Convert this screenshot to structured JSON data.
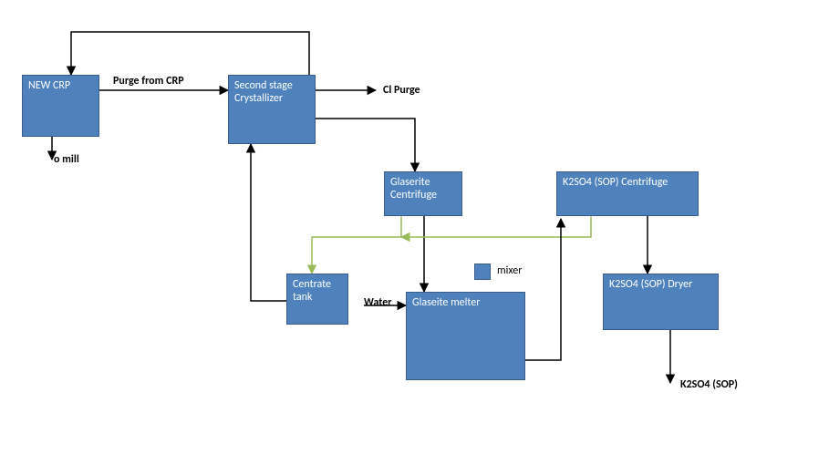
{
  "boxes": {
    "new_crp": "NEW CRP",
    "second_stage": "Second stage Crystallizer",
    "glaserite_centrifuge": "Glaserite Centrifuge",
    "k2so4_centrifuge": "K2SO4  (SOP) Centrifuge",
    "centrate_tank": "Centrate tank",
    "glaseite_melter": "Glaseite melter",
    "k2so4_dryer": "K2SO4   (SOP) Dryer"
  },
  "labels": {
    "purge_from_crp": "Purge from CRP",
    "cl_purge": "Cl Purge",
    "to_mill": "o mill",
    "mixer": "mixer",
    "water": "Water",
    "k2so4_sop": "K2SO4 (SOP)"
  },
  "colors": {
    "box_fill": "#4f81bd",
    "box_border": "#385d8a",
    "arrow_black": "#000000",
    "arrow_green": "#9bbb59"
  }
}
